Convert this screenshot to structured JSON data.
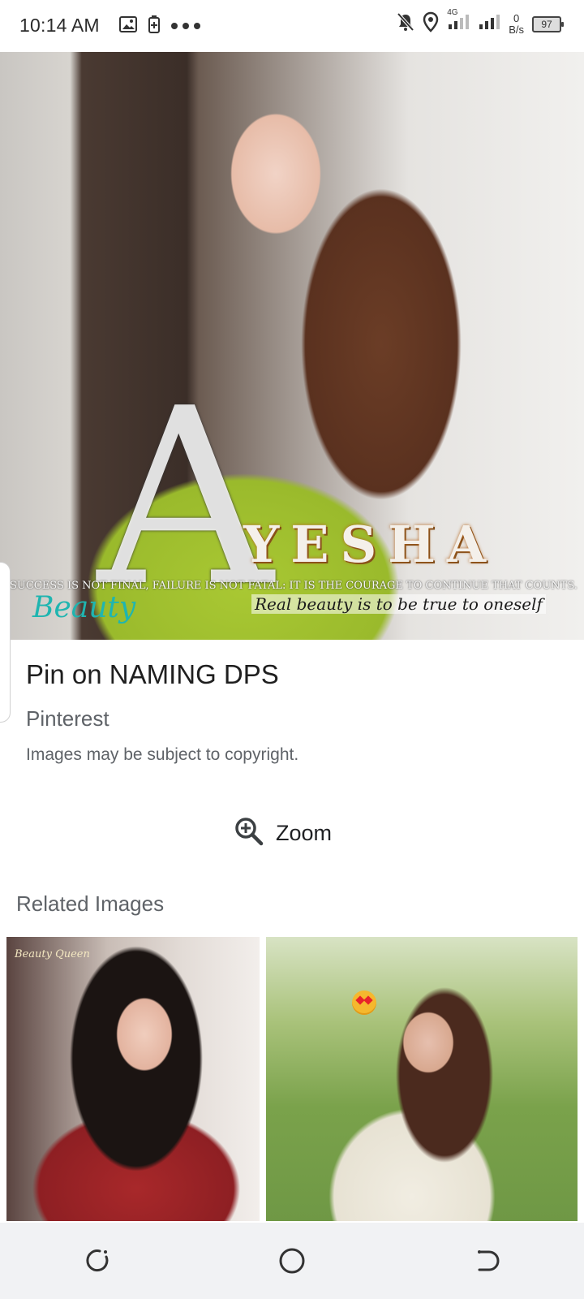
{
  "status_bar": {
    "time": "10:14 AM",
    "net_speed_value": "0",
    "net_speed_unit": "B/s",
    "battery": "97",
    "network_type": "4G",
    "icons": [
      "image-icon",
      "battery-saver-icon",
      "more-dots-icon",
      "mute-icon",
      "location-icon",
      "signal-icon",
      "signal-icon"
    ]
  },
  "hero": {
    "overlay_letter": "A",
    "overlay_name": "YESHA",
    "overlay_quote": "SUCCESS IS NOT FINAL, FAILURE IS NOT FATAL: IT IS THE COURAGE TO CONTINUE THAT COUNTS.",
    "overlay_script": "Beauty",
    "overlay_caption": "Real beauty is to be true to oneself"
  },
  "pin": {
    "title": "Pin on NAMING DPS",
    "source": "Pinterest",
    "copyright": "Images may be subject to copyright."
  },
  "zoom": {
    "label": "Zoom",
    "icon": "zoom-in-icon"
  },
  "related": {
    "title": "Related Images",
    "items": [
      {
        "overlay_text": "Beauty Queen"
      },
      {
        "overlay_text": ""
      }
    ]
  },
  "nav": {
    "icons": [
      "recent-apps-icon",
      "home-icon",
      "back-icon"
    ]
  },
  "colors": {
    "status_text": "#2b2b2b",
    "secondary_text": "#5f6368",
    "navbar_bg": "#f1f2f4"
  }
}
